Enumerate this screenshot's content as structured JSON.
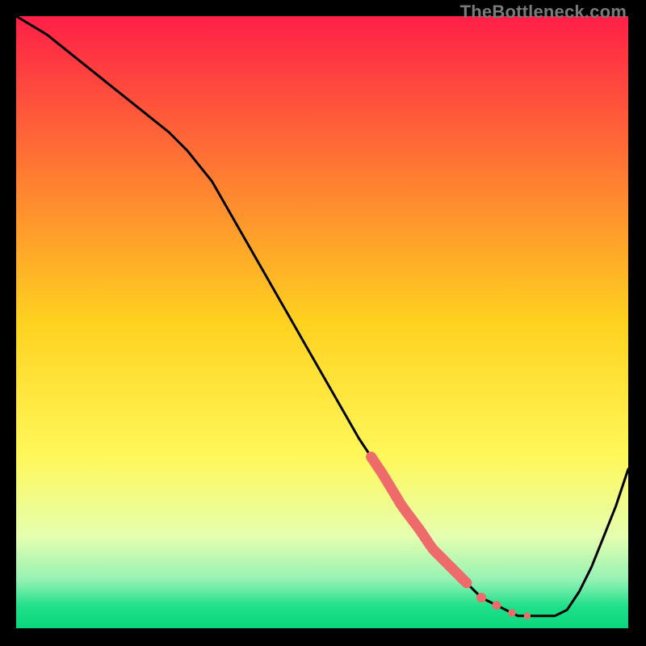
{
  "watermark": "TheBottleneck.com",
  "chart_data": {
    "type": "line",
    "title": "",
    "xlabel": "",
    "ylabel": "",
    "xlim": [
      0,
      100
    ],
    "ylim": [
      0,
      100
    ],
    "grid": false,
    "background_gradient": {
      "stops": [
        {
          "pos": 0.0,
          "color": "#ff1f47"
        },
        {
          "pos": 0.5,
          "color": "#ffd21f"
        },
        {
          "pos": 0.72,
          "color": "#fff85a"
        },
        {
          "pos": 0.85,
          "color": "#e5ffb0"
        },
        {
          "pos": 0.92,
          "color": "#96f2b4"
        },
        {
          "pos": 0.965,
          "color": "#1fe08a"
        },
        {
          "pos": 1.0,
          "color": "#09d67a"
        }
      ]
    },
    "series": [
      {
        "name": "bottleneck-curve",
        "color": "#000000",
        "x": [
          0,
          5,
          10,
          15,
          20,
          25,
          28,
          32,
          36,
          40,
          44,
          48,
          52,
          56,
          60,
          63,
          66,
          68,
          70,
          72,
          74,
          76,
          78,
          80,
          82,
          84,
          86,
          88,
          90,
          92,
          94,
          96,
          98,
          100
        ],
        "y": [
          100,
          97,
          93,
          89,
          85,
          81,
          78,
          73,
          66,
          59,
          52,
          45,
          38,
          31,
          25,
          20,
          16,
          13,
          11,
          9,
          7,
          5,
          4,
          3,
          2,
          2,
          2,
          2,
          3,
          6,
          10,
          15,
          20,
          26
        ]
      }
    ],
    "highlight_segment": {
      "name": "highlight-dots",
      "color": "#ef6a6a",
      "along_series": "bottleneck-curve",
      "x_start": 58,
      "x_end": 82,
      "style": "thick-dots"
    }
  }
}
